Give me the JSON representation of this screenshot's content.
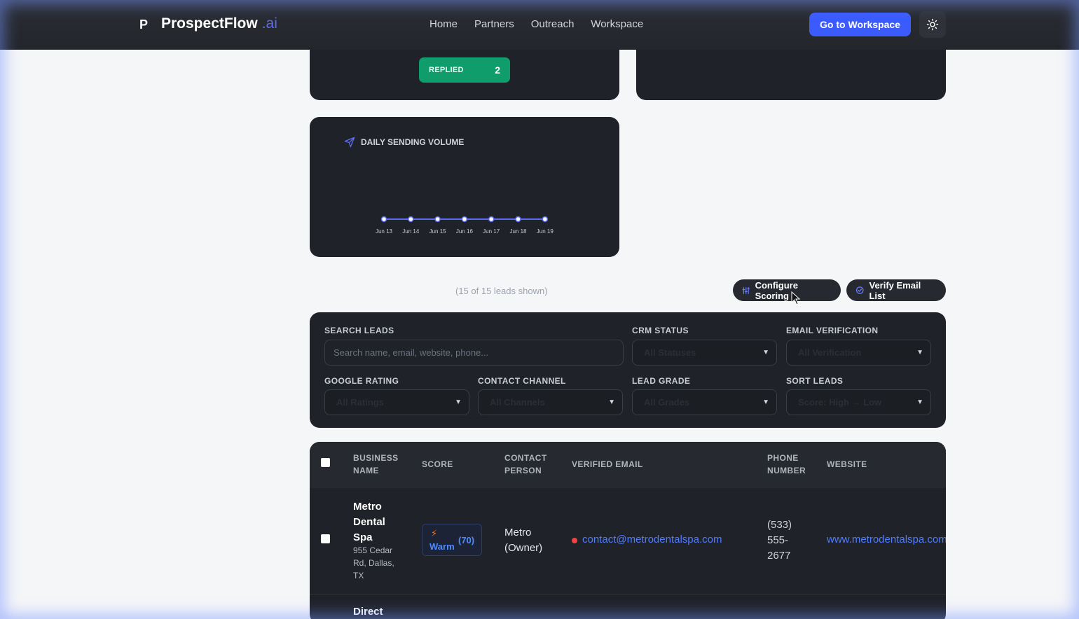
{
  "nav": {
    "brand_letter": "P",
    "brand_name": "ProspectFlow",
    "brand_suffix": ".ai",
    "links": [
      "Home",
      "Partners",
      "Outreach",
      "Workspace"
    ],
    "cta_label": "Go to Workspace",
    "theme_icon": "sun-icon"
  },
  "stats": {
    "replied_label": "REPLIED",
    "replied_value": "2"
  },
  "daily_volume": {
    "title": "DAILY SENDING VOLUME",
    "icon": "send-icon"
  },
  "chart_data": {
    "type": "line",
    "title": "DAILY SENDING VOLUME",
    "x": [
      "Jun 13",
      "Jun 14",
      "Jun 15",
      "Jun 16",
      "Jun 17",
      "Jun 18",
      "Jun 19"
    ],
    "series": [
      {
        "values": [
          0,
          0,
          0,
          0,
          0,
          0,
          0
        ]
      }
    ],
    "ylim": [
      0,
      1
    ],
    "grid": false,
    "colors": {
      "line": "#5b6cf0",
      "point_fill": "#ffffff"
    }
  },
  "toolbar": {
    "leads_count": "(15 of 15 leads shown)",
    "configure_label": "Configure Scoring",
    "verify_label": "Verify Email List"
  },
  "filters": {
    "search_label": "SEARCH LEADS",
    "search_placeholder": "Search name, email, website, phone...",
    "crm_label": "CRM STATUS",
    "crm_value": "All Statuses",
    "email_label": "EMAIL VERIFICATION",
    "email_value": "All Verification",
    "rating_label": "GOOGLE RATING",
    "rating_value": "All Ratings",
    "channel_label": "CONTACT CHANNEL",
    "channel_value": "All Channels",
    "grade_label": "LEAD GRADE",
    "grade_value": "All Grades",
    "sort_label": "SORT LEADS",
    "sort_value": "Score: High → Low"
  },
  "table": {
    "headers": {
      "business": [
        "BUSINESS",
        "NAME"
      ],
      "score": "SCORE",
      "contact": [
        "CONTACT",
        "PERSON"
      ],
      "email": "VERIFIED EMAIL",
      "phone": [
        "PHONE",
        "NUMBER"
      ],
      "website": "WEBSITE"
    },
    "rows": [
      {
        "name": [
          "Metro",
          "Dental",
          "Spa"
        ],
        "address": [
          "955 Cedar",
          "Rd, Dallas,",
          "TX"
        ],
        "score_label": "Warm",
        "score_value": "(70)",
        "contact": [
          "Metro",
          "(Owner)"
        ],
        "email": "contact@metrodentalspa.com",
        "phone": [
          "(533)",
          "555-",
          "2677"
        ],
        "website": "www.metrodentalspa.com"
      },
      {
        "name": [
          "Direct"
        ]
      }
    ]
  },
  "colors": {
    "accent": "#3b5bfd",
    "replied": "#0f9d6b",
    "warm": "#4f8cff",
    "email_status": "#ef4444"
  }
}
